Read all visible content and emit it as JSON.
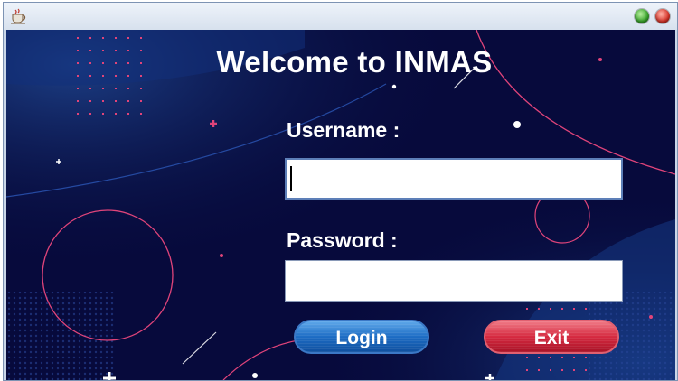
{
  "window": {
    "icon": "java-cup-icon",
    "controls": {
      "minimize": "minimize-icon",
      "close": "close-icon"
    }
  },
  "login_form": {
    "title": "Welcome to INMAS",
    "username_label": "Username :",
    "username_value": "",
    "password_label": "Password :",
    "password_value": "",
    "login_label": "Login",
    "exit_label": "Exit"
  },
  "colors": {
    "background": "#070a3c",
    "accent_pink": "#e0447a",
    "login_button": "#1d6cc4",
    "exit_button": "#d52a40"
  }
}
